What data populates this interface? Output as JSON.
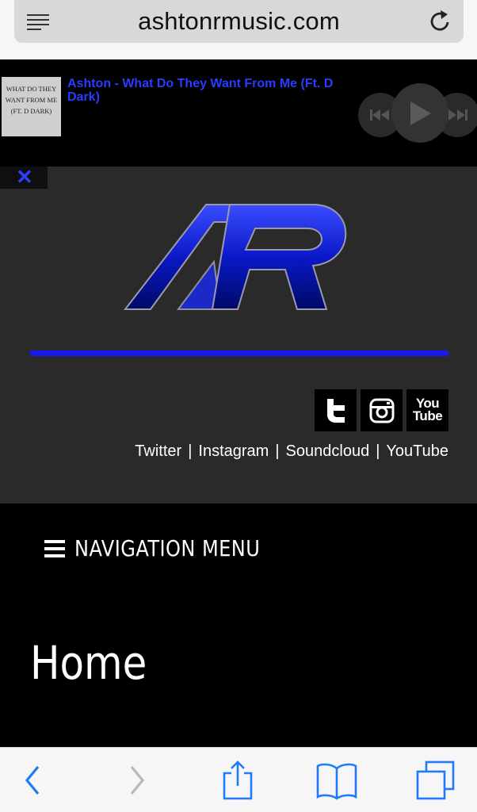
{
  "browser": {
    "url": "ashtonrmusic.com",
    "icons": [
      "reader-icon",
      "reload-icon"
    ]
  },
  "player": {
    "album_art_text": "What do they want from me (ft. D Dark)",
    "track_title": "Ashton - What Do They Want From Me (Ft. D Dark)",
    "controls": [
      "previous-icon",
      "play-icon",
      "next-icon"
    ]
  },
  "header": {
    "close_label": "✕",
    "logo": "AR",
    "accent_color": "#1a1aee",
    "social_icons": [
      "twitter-icon",
      "instagram-icon",
      "youtube-icon"
    ],
    "youtube_icon_text": [
      "You",
      "Tube"
    ],
    "social_links": [
      "Twitter",
      "Instagram",
      "Soundcloud",
      "YouTube"
    ],
    "separator": "|"
  },
  "nav": {
    "label": "NAVIGATION MENU"
  },
  "page": {
    "title": "Home"
  },
  "toolbar": {
    "buttons": [
      "back-icon",
      "forward-icon",
      "share-icon",
      "bookmarks-icon",
      "tabs-icon"
    ],
    "accent_color": "#1f7cf5"
  }
}
